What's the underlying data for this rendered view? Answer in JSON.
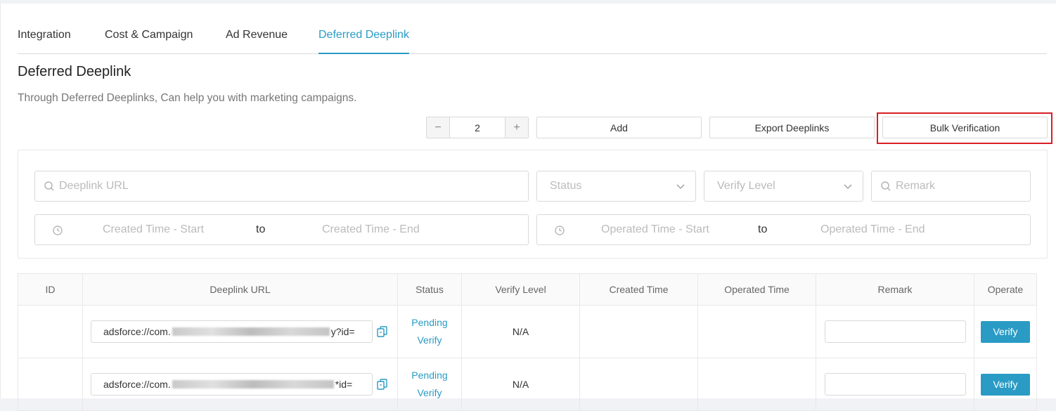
{
  "tabs": [
    {
      "label": "Integration"
    },
    {
      "label": "Cost & Campaign"
    },
    {
      "label": "Ad Revenue"
    },
    {
      "label": "Deferred Deeplink"
    }
  ],
  "active_tab": "Deferred Deeplink",
  "page": {
    "title": "Deferred Deeplink",
    "description": "Through Deferred Deeplinks, Can help you with marketing campaigns."
  },
  "toolbar": {
    "quantity": "2",
    "minus": "−",
    "plus": "+",
    "add_label": "Add",
    "export_label": "Export Deeplinks",
    "bulk_label": "Bulk Verification"
  },
  "filters": {
    "deeplink_url_placeholder": "Deeplink URL",
    "status_placeholder": "Status",
    "verify_level_placeholder": "Verify Level",
    "remark_placeholder": "Remark",
    "created_start": "Created Time - Start",
    "created_to": "to",
    "created_end": "Created Time - End",
    "operated_start": "Operated Time - Start",
    "operated_to": "to",
    "operated_end": "Operated Time - End"
  },
  "table": {
    "columns": [
      "ID",
      "Deeplink URL",
      "Status",
      "Verify Level",
      "Created Time",
      "Operated Time",
      "Remark",
      "Operate"
    ],
    "rows": [
      {
        "id": "",
        "url_prefix": "adsforce://com.",
        "url_suffix": "y?id=",
        "status_line1": "Pending",
        "status_line2": "Verify",
        "verify_level": "N/A",
        "created": "",
        "operated": "",
        "operate": "Verify"
      },
      {
        "id": "",
        "url_prefix": "adsforce://com.",
        "url_suffix": "*id=",
        "status_line1": "Pending",
        "status_line2": "Verify",
        "verify_level": "N/A",
        "created": "",
        "operated": "",
        "operate": "Verify"
      }
    ]
  },
  "colors": {
    "accent": "#2a9bc4",
    "highlight_border": "#d81e25"
  }
}
